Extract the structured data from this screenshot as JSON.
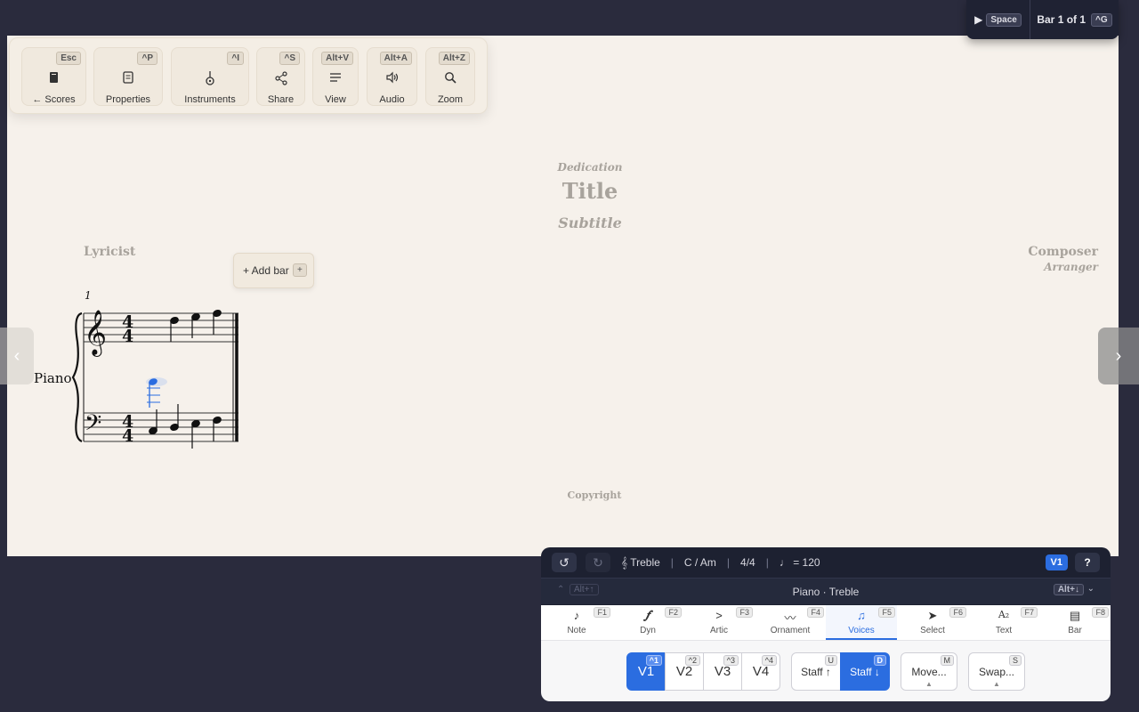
{
  "toolbar": {
    "buttons": [
      {
        "label": "← Scores",
        "key": "Esc",
        "icon": "scores-icon"
      },
      {
        "label": "Properties",
        "key": "^P",
        "icon": "properties-icon"
      },
      {
        "label": "Instruments",
        "key": "^I",
        "icon": "instruments-icon"
      },
      {
        "label": "Share",
        "key": "^S",
        "icon": "share-icon"
      },
      {
        "label": "View",
        "key": "Alt+V",
        "icon": "view-icon"
      },
      {
        "label": "Audio",
        "key": "Alt+A",
        "icon": "audio-icon"
      },
      {
        "label": "Zoom",
        "key": "Alt+Z",
        "icon": "zoom-icon"
      }
    ]
  },
  "playbar": {
    "play_key": "Space",
    "bar_status": "Bar 1 of 1",
    "goto_key": "^G"
  },
  "score": {
    "dedication": "Dedication",
    "title": "Title",
    "subtitle": "Subtitle",
    "lyricist": "Lyricist",
    "composer": "Composer",
    "arranger": "Arranger",
    "copyright": "Copyright",
    "instrument": "Piano",
    "bar_number": "1",
    "add_bar_label": "+ Add bar",
    "add_bar_key": "+",
    "time_sig_top": "4",
    "time_sig_bottom": "4"
  },
  "status": {
    "clef": "𝄞 Treble",
    "key": "C / Am",
    "time": "4/4",
    "tempo": "♩ = 120",
    "voice_badge": "V1",
    "help": "?"
  },
  "context": {
    "up_key": "Alt+↑",
    "title": "Piano · Treble",
    "down_key": "Alt+↓"
  },
  "tabs": [
    {
      "label": "Note",
      "key": "F1",
      "icon": "♪"
    },
    {
      "label": "Dyn",
      "key": "F2",
      "icon": "𝆑"
    },
    {
      "label": "Artic",
      "key": "F3",
      "icon": ">"
    },
    {
      "label": "Ornament",
      "key": "F4",
      "icon": "〰"
    },
    {
      "label": "Voices",
      "key": "F5",
      "icon": "♫"
    },
    {
      "label": "Select",
      "key": "F6",
      "icon": "➤"
    },
    {
      "label": "Text",
      "key": "F7",
      "icon": "A₂"
    },
    {
      "label": "Bar",
      "key": "F8",
      "icon": "▤"
    }
  ],
  "voices": [
    {
      "label": "V1",
      "key": "^1"
    },
    {
      "label": "V2",
      "key": "^2"
    },
    {
      "label": "V3",
      "key": "^3"
    },
    {
      "label": "V4",
      "key": "^4"
    }
  ],
  "staff_buttons": [
    {
      "label": "Staff ↑",
      "key": "U"
    },
    {
      "label": "Staff ↓",
      "key": "D"
    }
  ],
  "actions": [
    {
      "label": "Move...",
      "key": "M"
    },
    {
      "label": "Swap...",
      "key": "S"
    }
  ],
  "colors": {
    "accent": "#2b6de0",
    "panel": "#1d2131",
    "paper": "#f6f1eb"
  }
}
